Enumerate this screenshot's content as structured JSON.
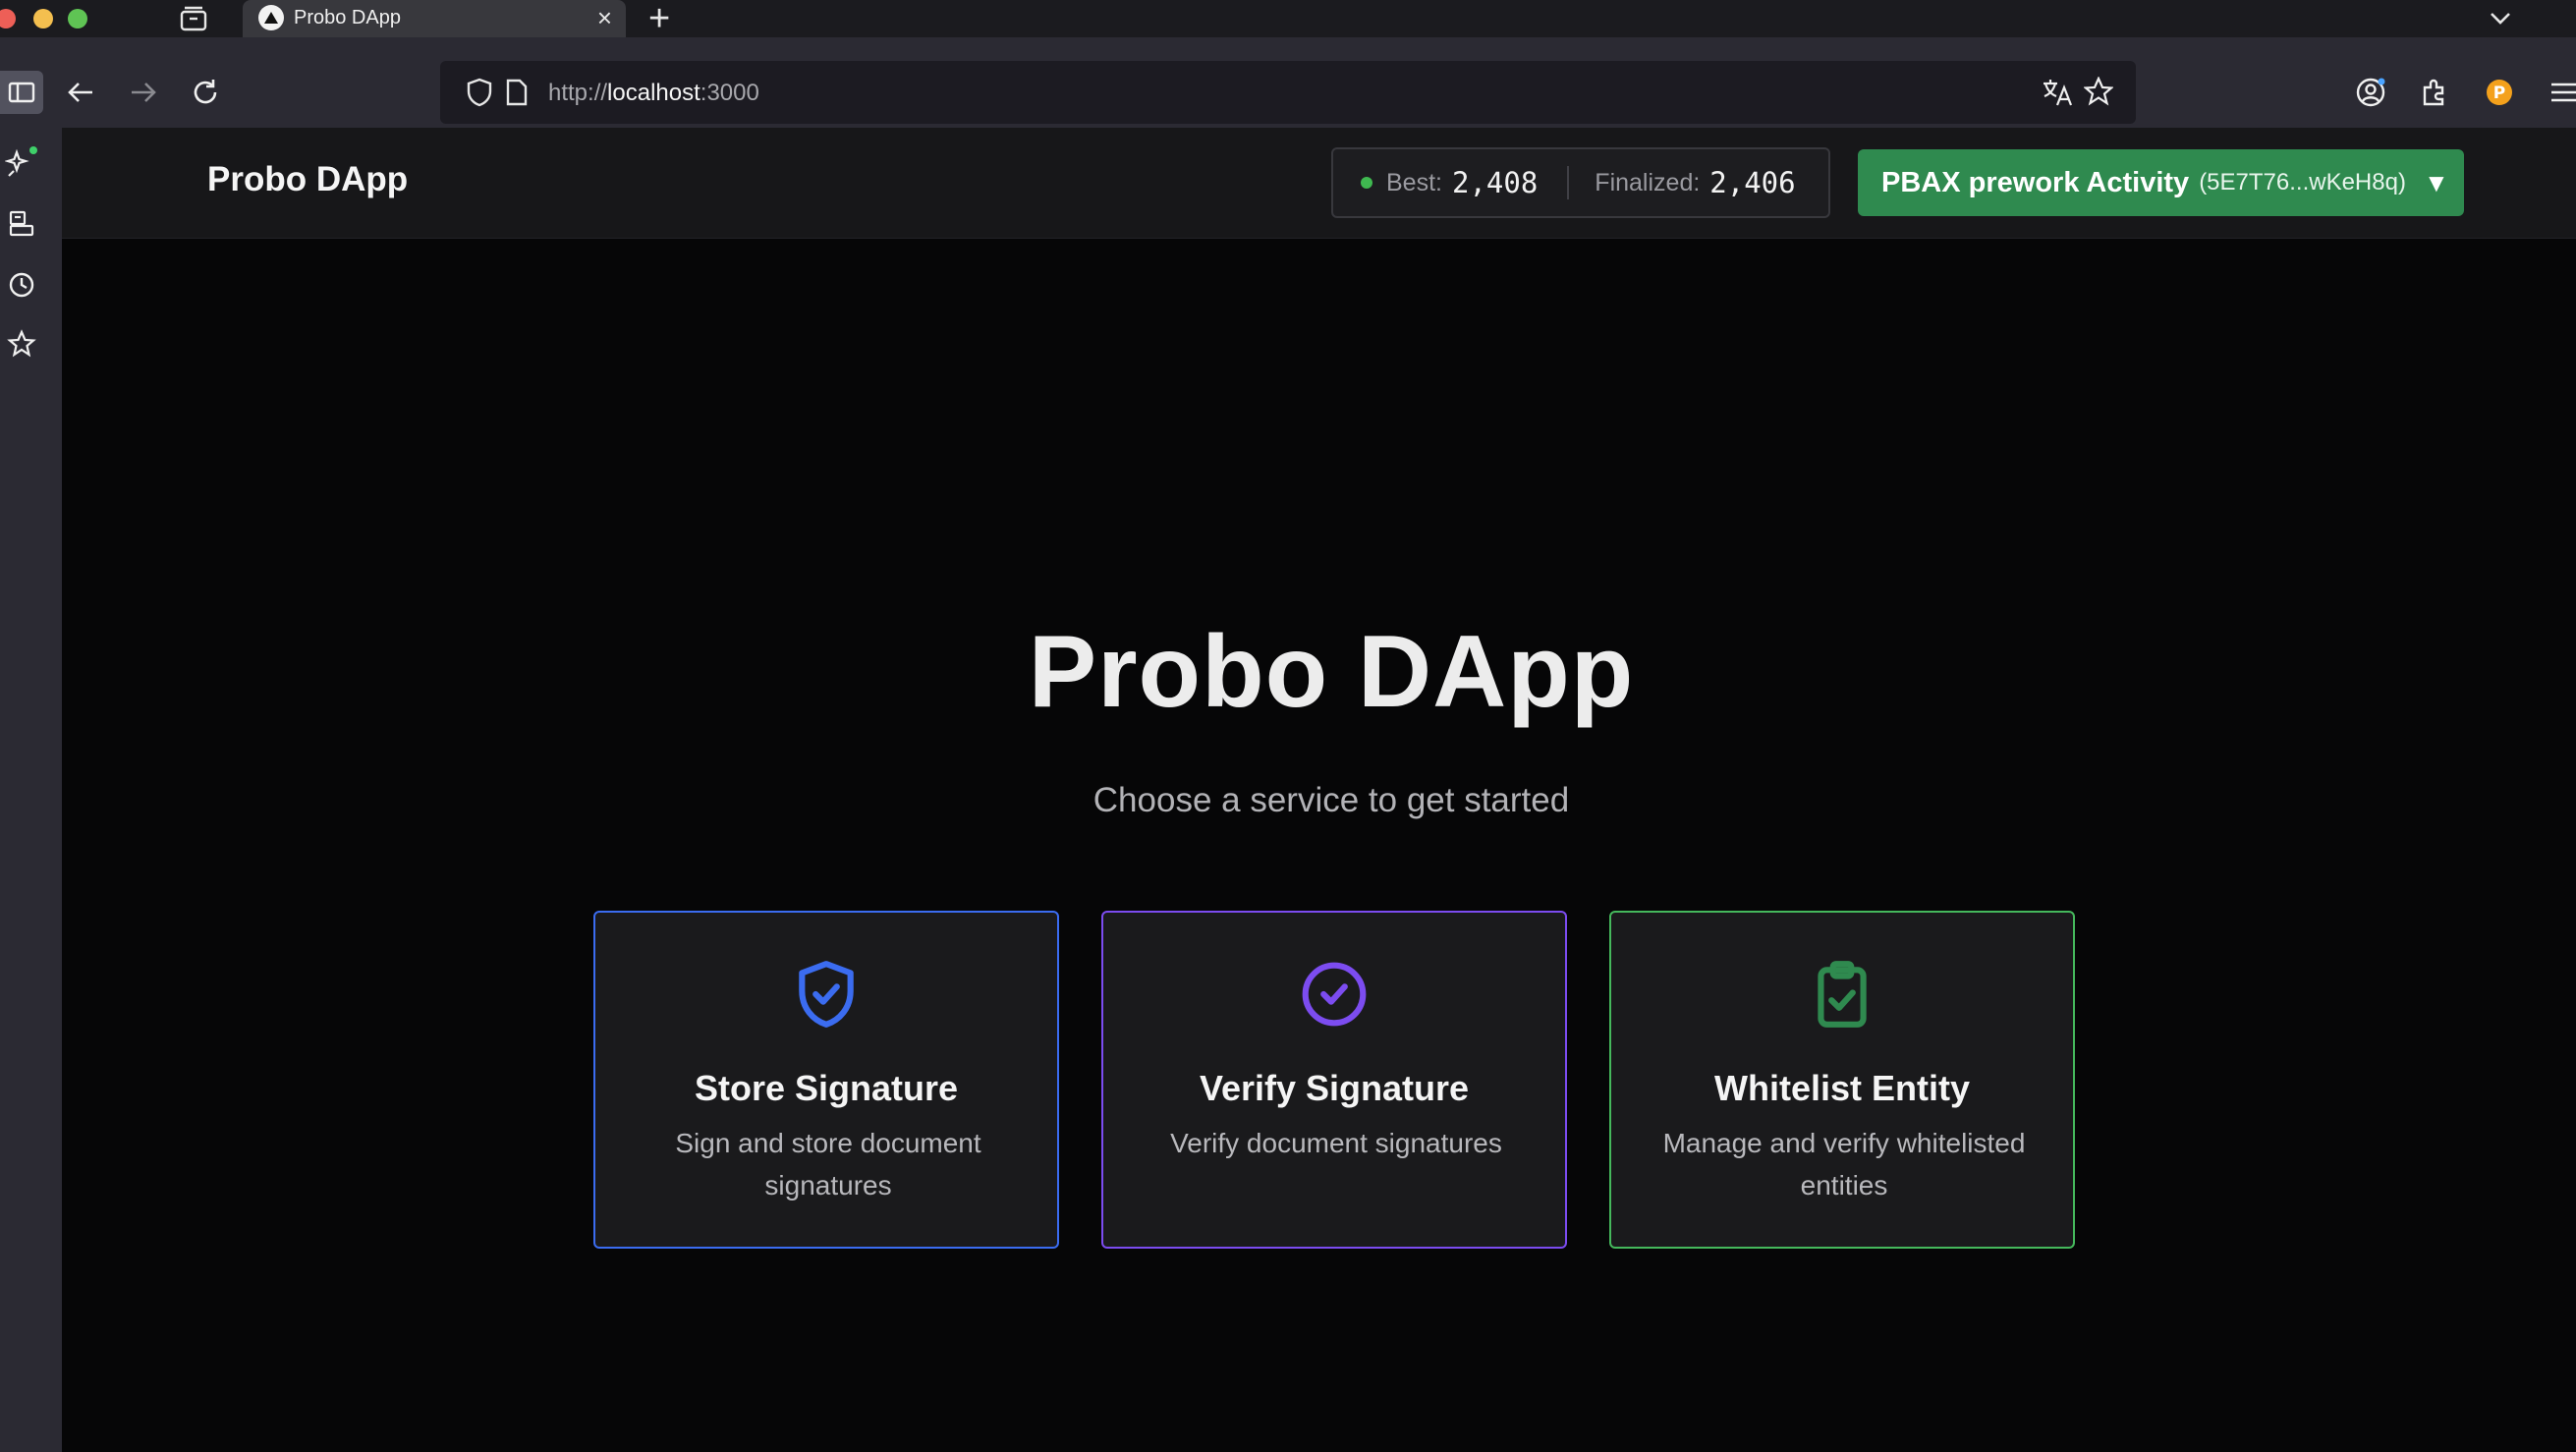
{
  "browser": {
    "tab": {
      "title": "Probo DApp"
    },
    "new_tab_label": "+",
    "close_label": "×",
    "url": {
      "prefix": "http://",
      "host": "localhost",
      "suffix": ":3000"
    }
  },
  "app": {
    "brand": "Probo DApp",
    "status": {
      "best_label": "Best:",
      "best_value": "2,408",
      "finalized_label": "Finalized:",
      "finalized_value": "2,406",
      "dot_color": "#3fb950"
    },
    "account": {
      "name": "PBAX prework Activity",
      "address": "(5E7T76...wKeH8q)",
      "caret": "▼",
      "color": "#2f8a4f"
    }
  },
  "hero": {
    "title": "Probo DApp",
    "subtitle": "Choose a service to get started"
  },
  "cards": [
    {
      "title": "Store Signature",
      "description": "Sign and store document signatures",
      "icon": "shield-check-icon",
      "color": "#3b6cf0"
    },
    {
      "title": "Verify Signature",
      "description": "Verify document signatures",
      "icon": "circle-check-icon",
      "color": "#7c4cf0"
    },
    {
      "title": "Whitelist Entity",
      "description": "Manage and verify whitelisted entities",
      "icon": "clipboard-check-icon",
      "color": "#45b85c"
    }
  ]
}
